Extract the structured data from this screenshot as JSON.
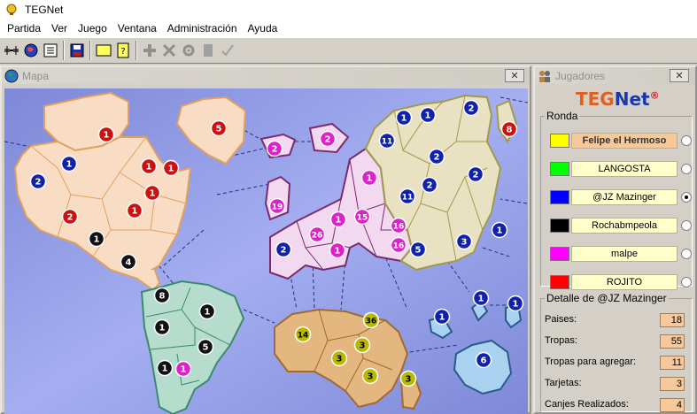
{
  "app": {
    "title": "TEGNet"
  },
  "menu": [
    "Partida",
    "Ver",
    "Juego",
    "Ventana",
    "Administración",
    "Ayuda"
  ],
  "toolbar": [
    {
      "icon": "connect-icon",
      "enabled": true
    },
    {
      "icon": "globe-icon",
      "enabled": true
    },
    {
      "icon": "list-icon",
      "enabled": true
    },
    {
      "icon": "save-icon",
      "enabled": true
    },
    {
      "icon": "card-icon",
      "enabled": true
    },
    {
      "icon": "mission-icon",
      "enabled": true
    },
    {
      "icon": "add-icon",
      "enabled": false
    },
    {
      "icon": "attack-icon",
      "enabled": false
    },
    {
      "icon": "regroup-icon",
      "enabled": false
    },
    {
      "icon": "document-icon",
      "enabled": false
    },
    {
      "icon": "check-icon",
      "enabled": false
    }
  ],
  "map_window": {
    "title": "Mapa",
    "close": "✕"
  },
  "players_window": {
    "title": "Jugadores",
    "close": "✕"
  },
  "logo": {
    "teg": "TEG",
    "net": "Net",
    "reg": "®"
  },
  "round": {
    "legend": "Ronda",
    "players": [
      {
        "name": "Felipe el Hermoso",
        "color": "#ffff00",
        "active": true,
        "selected": false
      },
      {
        "name": "LANGOSTA",
        "color": "#00ff00",
        "active": false,
        "selected": false
      },
      {
        "name": "@JZ Mazinger",
        "color": "#0000ff",
        "active": false,
        "selected": true
      },
      {
        "name": "Rochabmpeola",
        "color": "#000000",
        "active": false,
        "selected": false
      },
      {
        "name": "malpe",
        "color": "#ff00ff",
        "active": false,
        "selected": false
      },
      {
        "name": "ROJITO",
        "color": "#ff0000",
        "active": false,
        "selected": false
      }
    ]
  },
  "detail": {
    "legend": "Detalle de @JZ Mazinger",
    "rows": [
      {
        "label": "Paises:",
        "value": "18"
      },
      {
        "label": "Tropas:",
        "value": "55"
      },
      {
        "label": "Tropas para agregar:",
        "value": "11"
      },
      {
        "label": "Tarjetas:",
        "value": "3"
      },
      {
        "label": "Canjes Realizados:",
        "value": "4"
      }
    ]
  },
  "colors": {
    "red": "#cc1111",
    "blue": "#1122aa",
    "black": "#111111",
    "magenta": "#dd22cc",
    "olive": "#b8b800",
    "north_america": "#f8ddc4",
    "south_america": "#b5dccd",
    "europe": "#f3d9f0",
    "asia": "#e9e2c2",
    "africa": "#e3b77f",
    "oceania": "#a9d2f1"
  },
  "markers": [
    {
      "player": "red",
      "troops": "1"
    },
    {
      "player": "red",
      "troops": "5"
    },
    {
      "player": "blue",
      "troops": "1"
    },
    {
      "player": "blue",
      "troops": "2"
    },
    {
      "player": "red",
      "troops": "1"
    },
    {
      "player": "red",
      "troops": "1"
    },
    {
      "player": "red",
      "troops": "1"
    },
    {
      "player": "red",
      "troops": "1"
    },
    {
      "player": "red",
      "troops": "2"
    },
    {
      "player": "black",
      "troops": "1"
    },
    {
      "player": "black",
      "troops": "4"
    },
    {
      "player": "black",
      "troops": "8"
    },
    {
      "player": "black",
      "troops": "1"
    },
    {
      "player": "black",
      "troops": "1"
    },
    {
      "player": "black",
      "troops": "5"
    },
    {
      "player": "black",
      "troops": "1"
    },
    {
      "player": "magenta",
      "troops": "1"
    },
    {
      "player": "magenta",
      "troops": "2"
    },
    {
      "player": "magenta",
      "troops": "2"
    },
    {
      "player": "magenta",
      "troops": "19"
    },
    {
      "player": "magenta",
      "troops": "1"
    },
    {
      "player": "magenta",
      "troops": "1"
    },
    {
      "player": "magenta",
      "troops": "26"
    },
    {
      "player": "magenta",
      "troops": "15"
    },
    {
      "player": "magenta",
      "troops": "16"
    },
    {
      "player": "magenta",
      "troops": "1"
    },
    {
      "player": "magenta",
      "troops": "16"
    },
    {
      "player": "blue",
      "troops": "2"
    },
    {
      "player": "blue",
      "troops": "1"
    },
    {
      "player": "blue",
      "troops": "1"
    },
    {
      "player": "blue",
      "troops": "2"
    },
    {
      "player": "blue",
      "troops": "11"
    },
    {
      "player": "blue",
      "troops": "2"
    },
    {
      "player": "blue",
      "troops": "2"
    },
    {
      "player": "blue",
      "troops": "2"
    },
    {
      "player": "blue",
      "troops": "11"
    },
    {
      "player": "red",
      "troops": "8"
    },
    {
      "player": "blue",
      "troops": "3"
    },
    {
      "player": "blue",
      "troops": "1"
    },
    {
      "player": "blue",
      "troops": "5"
    },
    {
      "player": "olive",
      "troops": "36"
    },
    {
      "player": "olive",
      "troops": "14"
    },
    {
      "player": "olive",
      "troops": "3"
    },
    {
      "player": "olive",
      "troops": "3"
    },
    {
      "player": "olive",
      "troops": "3"
    },
    {
      "player": "olive",
      "troops": "3"
    },
    {
      "player": "blue",
      "troops": "1"
    },
    {
      "player": "blue",
      "troops": "1"
    },
    {
      "player": "blue",
      "troops": "1"
    },
    {
      "player": "blue",
      "troops": "6"
    }
  ]
}
